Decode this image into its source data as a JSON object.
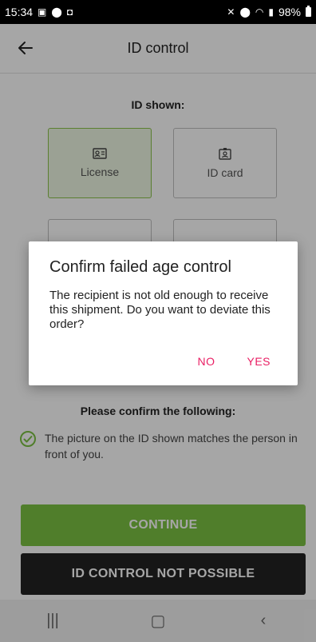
{
  "status_bar": {
    "time": "15:34",
    "battery": "98%"
  },
  "app_bar": {
    "title": "ID control"
  },
  "id_section": {
    "label": "ID shown:",
    "options": [
      {
        "label": "License",
        "selected": true
      },
      {
        "label": "ID card",
        "selected": false
      }
    ]
  },
  "confirm_section": {
    "label": "Please confirm the following:",
    "check_text": "The picture on the ID shown matches the person in front of you."
  },
  "buttons": {
    "continue": "CONTINUE",
    "not_possible": "ID CONTROL NOT POSSIBLE"
  },
  "dialog": {
    "title": "Confirm failed age control",
    "message": "The recipient is not old enough to receive this shipment. Do you want to deviate this order?",
    "no": "NO",
    "yes": "YES"
  },
  "colors": {
    "accent_green": "#7cc242",
    "dialog_action": "#e91e63",
    "dark_button": "#222222"
  }
}
